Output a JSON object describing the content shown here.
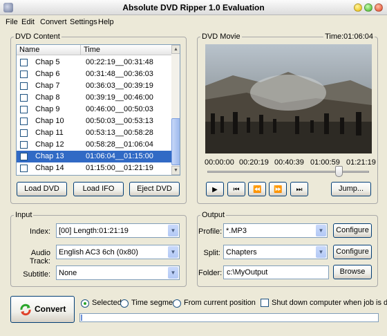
{
  "window": {
    "title": "Absolute DVD Ripper 1.0 Evaluation"
  },
  "menu": [
    "File",
    "Edit",
    "Convert",
    "Settings",
    "Help"
  ],
  "dvd_content": {
    "label": "DVD Content",
    "columns": [
      "Name",
      "Time"
    ],
    "rows": [
      {
        "name": "Chap  5",
        "time": "00:22:19__00:31:48",
        "checked": false
      },
      {
        "name": "Chap  6",
        "time": "00:31:48__00:36:03",
        "checked": false
      },
      {
        "name": "Chap  7",
        "time": "00:36:03__00:39:19",
        "checked": false
      },
      {
        "name": "Chap  8",
        "time": "00:39:19__00:46:00",
        "checked": false
      },
      {
        "name": "Chap  9",
        "time": "00:46:00__00:50:03",
        "checked": false
      },
      {
        "name": "Chap 10",
        "time": "00:50:03__00:53:13",
        "checked": false
      },
      {
        "name": "Chap 11",
        "time": "00:53:13__00:58:28",
        "checked": false
      },
      {
        "name": "Chap 12",
        "time": "00:58:28__01:06:04",
        "checked": false
      },
      {
        "name": "Chap 13",
        "time": "01:06:04__01:15:00",
        "checked": true,
        "selected": true
      },
      {
        "name": "Chap 14",
        "time": "01:15:00__01:21:19",
        "checked": false
      }
    ],
    "buttons": {
      "load_dvd": "Load DVD",
      "load_ifo": "Load IFO",
      "eject_dvd": "Eject DVD"
    }
  },
  "dvd_movie": {
    "label": "DVD Movie",
    "time": "Time:01:06:04",
    "timeline_labels": [
      "00:00:00",
      "00:20:19",
      "00:40:39",
      "01:00:59",
      "01:21:19"
    ],
    "slider_position": 0.83,
    "jump_label": "Jump...",
    "icons": {
      "play": "play-icon",
      "first": "skip-to-start-icon",
      "rewind": "rewind-icon",
      "forward": "fast-forward-icon",
      "last": "skip-to-end-icon"
    }
  },
  "input": {
    "label": "Input",
    "index_label": "Index:",
    "index_value": "[00] Length:01:21:19",
    "audio_label": "Audio Track:",
    "audio_value": "English AC3 6ch (0x80)",
    "subtitle_label": "Subtitle:",
    "subtitle_value": "None"
  },
  "output": {
    "label": "Output",
    "profile_label": "Profile:",
    "profile_value": "*.MP3",
    "split_label": "Split:",
    "split_value": "Chapters",
    "folder_label": "Folder:",
    "folder_value": "c:\\MyOutput",
    "configure_label": "Configure",
    "browse_label": "Browse"
  },
  "bottom": {
    "convert_label": "Convert",
    "radio_selected": "Selected",
    "radio_segment": "Time segment",
    "radio_current": "From current position",
    "shutdown_label": "Shut down computer when job is done"
  },
  "colors": {
    "selection": "#316ac5",
    "button_border": "#003c74",
    "field_border": "#7f9db9"
  }
}
